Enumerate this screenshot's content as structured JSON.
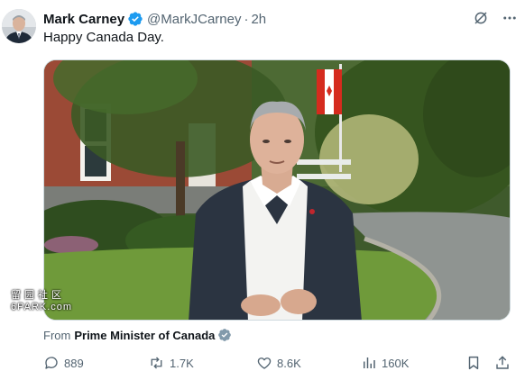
{
  "tweet": {
    "author_name": "Mark Carney",
    "handle": "@MarkJCarney",
    "separator": "·",
    "time": "2h",
    "text": "Happy Canada Day."
  },
  "media": {
    "watermark_line1": "留园社区",
    "watermark_line2": "6PARK.com"
  },
  "source": {
    "prefix": "From",
    "org": "Prime Minister of Canada"
  },
  "stats": {
    "replies": "889",
    "reposts": "1.7K",
    "likes": "8.6K",
    "views": "160K"
  },
  "icons": {
    "verified": "verified-badge-icon",
    "grok": "grok-icon",
    "more": "more-icon",
    "reply": "reply-icon",
    "repost": "repost-icon",
    "like": "heart-icon",
    "views": "views-icon",
    "bookmark": "bookmark-icon",
    "share": "share-icon"
  },
  "colors": {
    "verified_blue": "#1d9bf0",
    "muted_text": "#536471",
    "primary_text": "#0f1419",
    "affiliate_gray": "#829aab"
  }
}
